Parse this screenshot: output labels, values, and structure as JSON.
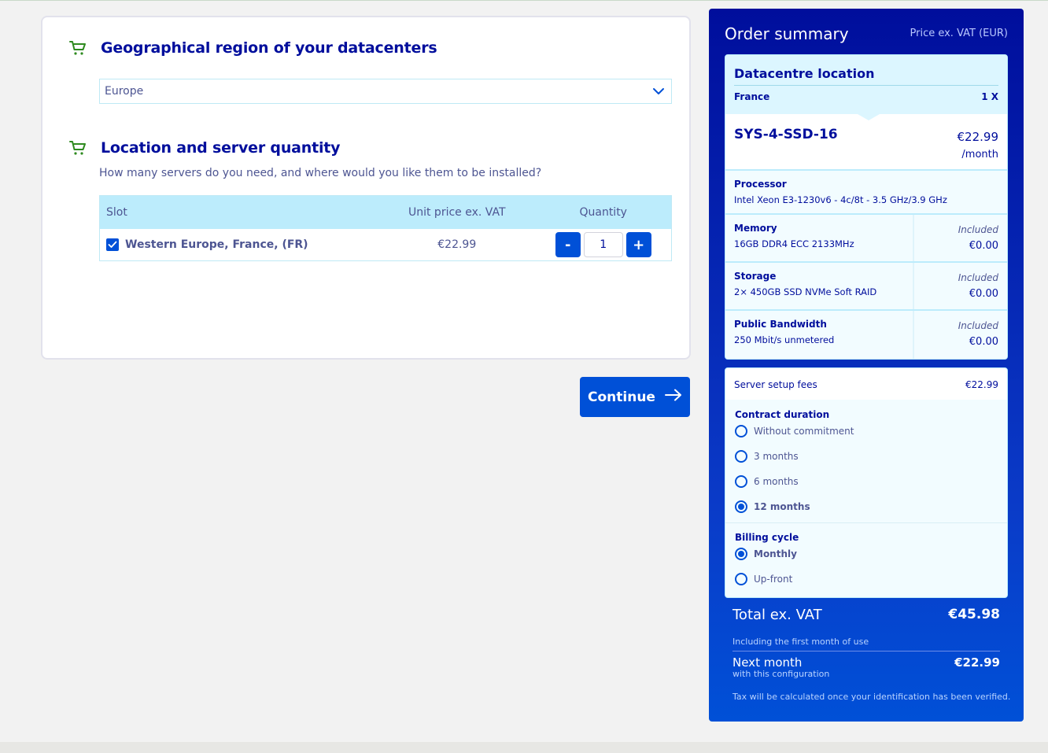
{
  "region": {
    "title": "Geographical region of your datacenters",
    "selected": "Europe"
  },
  "location": {
    "title": "Location and server quantity",
    "subtitle": "How many servers do you need, and where would you like them to be installed?",
    "columns": {
      "slot": "Slot",
      "price": "Unit price ex. VAT",
      "quantity": "Quantity"
    },
    "rows": [
      {
        "name": "Western Europe, France, (FR)",
        "price": "€22.99",
        "checked": true,
        "quantity": "1",
        "minus": "-",
        "plus": "+"
      }
    ]
  },
  "continue_label": "Continue",
  "summary": {
    "title": "Order summary",
    "vat_note": "Price ex. VAT (EUR)",
    "datacentre": {
      "title": "Datacentre location",
      "country": "France",
      "qty": "1 X"
    },
    "product": {
      "name": "SYS-4-SSD-16",
      "price": "€22.99",
      "period": "/month"
    },
    "specs": [
      {
        "name": "Processor",
        "value": "Intel Xeon E3-1230v6 - 4c/8t - 3.5 GHz/3.9 GHz",
        "included": "",
        "price": ""
      },
      {
        "name": "Memory",
        "value": "16GB DDR4 ECC 2133MHz",
        "included": "Included",
        "price": "€0.00"
      },
      {
        "name": "Storage",
        "value": "2× 450GB SSD NVMe Soft RAID",
        "included": "Included",
        "price": "€0.00"
      },
      {
        "name": "Public Bandwidth",
        "value": "250 Mbit/s unmetered",
        "included": "Included",
        "price": "€0.00"
      }
    ],
    "setup_fees": {
      "label": "Server setup fees",
      "value": "€22.99"
    },
    "contract": {
      "label": "Contract duration",
      "options": [
        "Without commitment",
        "3 months",
        "6 months",
        "12 months"
      ],
      "selected": "12 months"
    },
    "billing": {
      "label": "Billing cycle",
      "options": [
        "Monthly",
        "Up-front"
      ],
      "selected": "Monthly"
    },
    "total": {
      "label": "Total ex. VAT",
      "value": "€45.98",
      "note": "Including the first month of use"
    },
    "next_month": {
      "label": "Next month",
      "sub": "with this configuration",
      "value": "€22.99"
    },
    "tax_note": "Tax will be calculated once your identification has been verified."
  },
  "colors": {
    "brand_dark": "#000e9c",
    "accent": "#0050d7",
    "light_blue": "#bcecfc",
    "cart_green": "#2e8a1f"
  }
}
